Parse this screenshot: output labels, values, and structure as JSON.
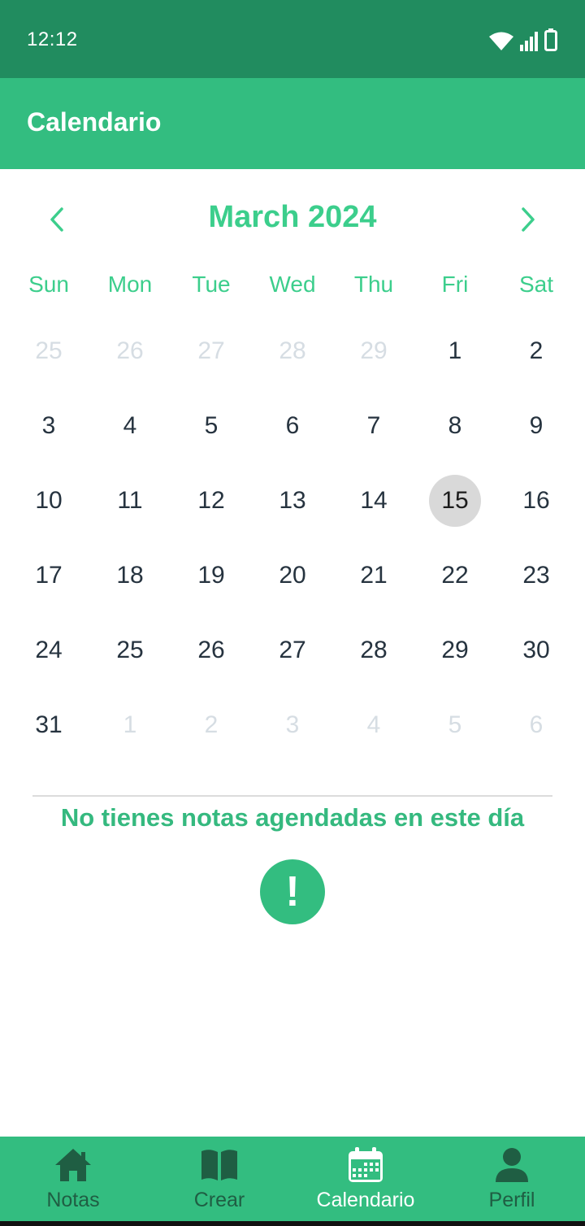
{
  "status_bar": {
    "time": "12:12"
  },
  "app_bar": {
    "title": "Calendario"
  },
  "calendar": {
    "month_label": "March 2024",
    "weekdays": [
      "Sun",
      "Mon",
      "Tue",
      "Wed",
      "Thu",
      "Fri",
      "Sat"
    ],
    "days": [
      {
        "label": "25",
        "muted": true
      },
      {
        "label": "26",
        "muted": true
      },
      {
        "label": "27",
        "muted": true
      },
      {
        "label": "28",
        "muted": true
      },
      {
        "label": "29",
        "muted": true
      },
      {
        "label": "1",
        "muted": false
      },
      {
        "label": "2",
        "muted": false
      },
      {
        "label": "3",
        "muted": false
      },
      {
        "label": "4",
        "muted": false
      },
      {
        "label": "5",
        "muted": false
      },
      {
        "label": "6",
        "muted": false
      },
      {
        "label": "7",
        "muted": false
      },
      {
        "label": "8",
        "muted": false
      },
      {
        "label": "9",
        "muted": false
      },
      {
        "label": "10",
        "muted": false
      },
      {
        "label": "11",
        "muted": false
      },
      {
        "label": "12",
        "muted": false
      },
      {
        "label": "13",
        "muted": false
      },
      {
        "label": "14",
        "muted": false
      },
      {
        "label": "15",
        "muted": false,
        "selected": true
      },
      {
        "label": "16",
        "muted": false
      },
      {
        "label": "17",
        "muted": false
      },
      {
        "label": "18",
        "muted": false
      },
      {
        "label": "19",
        "muted": false
      },
      {
        "label": "20",
        "muted": false
      },
      {
        "label": "21",
        "muted": false
      },
      {
        "label": "22",
        "muted": false
      },
      {
        "label": "23",
        "muted": false
      },
      {
        "label": "24",
        "muted": false
      },
      {
        "label": "25",
        "muted": false
      },
      {
        "label": "26",
        "muted": false
      },
      {
        "label": "27",
        "muted": false
      },
      {
        "label": "28",
        "muted": false
      },
      {
        "label": "29",
        "muted": false
      },
      {
        "label": "30",
        "muted": false
      },
      {
        "label": "31",
        "muted": false
      },
      {
        "label": "1",
        "muted": true
      },
      {
        "label": "2",
        "muted": true
      },
      {
        "label": "3",
        "muted": true
      },
      {
        "label": "4",
        "muted": true
      },
      {
        "label": "5",
        "muted": true
      },
      {
        "label": "6",
        "muted": true
      }
    ],
    "prev_icon": "chevron-left-icon",
    "next_icon": "chevron-right-icon"
  },
  "empty_state": {
    "message": "No tienes notas agendadas en este día",
    "icon": "!"
  },
  "bottom_nav": {
    "items": [
      {
        "label": "Notas",
        "icon": "home-icon",
        "active": false
      },
      {
        "label": "Crear",
        "icon": "book-icon",
        "active": false
      },
      {
        "label": "Calendario",
        "icon": "calendar-icon",
        "active": true
      },
      {
        "label": "Perfil",
        "icon": "person-icon",
        "active": false
      }
    ]
  },
  "colors": {
    "status_bar": "#218c5f",
    "primary": "#33bd80",
    "accent_text": "#3cce8c",
    "selected_day": "#d9d9d9",
    "nav_inactive": "#1f5e43"
  }
}
